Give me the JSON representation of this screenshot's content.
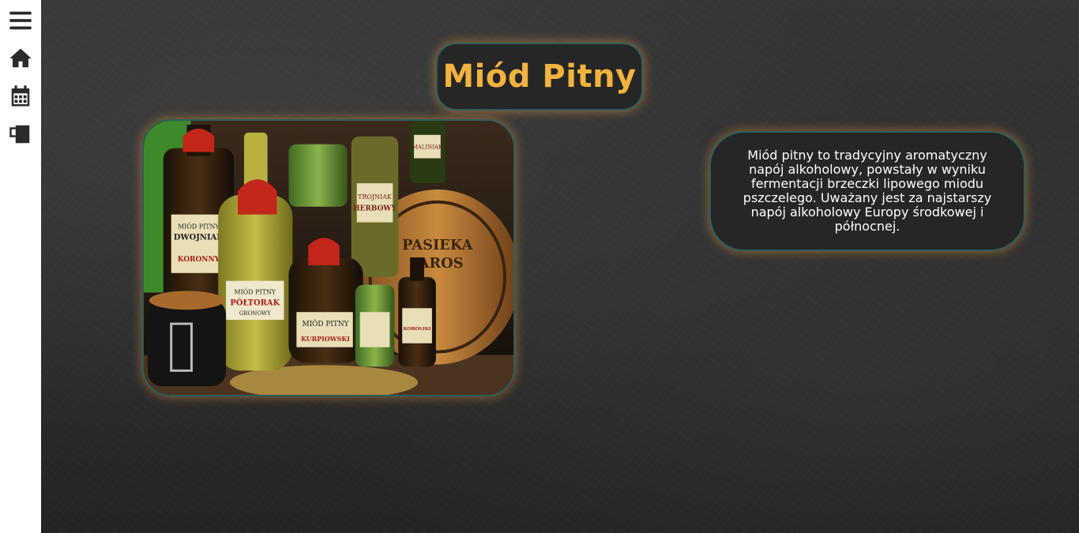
{
  "sidebar": {
    "items": [
      {
        "icon": "menu-icon"
      },
      {
        "icon": "home-icon"
      },
      {
        "icon": "calendar-icon"
      },
      {
        "icon": "mug-icon"
      }
    ]
  },
  "main": {
    "title": "Miód Pitny",
    "description": "Miód pitny to tradycyjny aromatyczny napój alkoholowy, powstały w wyniku fermentacji brzeczki lipowego miodu pszczelego. Uważany jest za najstarszy napój alkoholowy Europy środkowej i północnej.",
    "photo": {
      "labels": [
        "MIÓD PITNY",
        "DWOJNIAK",
        "KORONNY",
        "PÓŁTORAK",
        "GRONOWY",
        "TROJNIAK",
        "HERBOWY",
        "MALINIAK",
        "PASIEKA",
        "JAROS",
        "KURPIOWSKI",
        "KOROLIKI"
      ]
    }
  },
  "colors": {
    "accent": "#f3b23d",
    "border": "#2c5d5e",
    "glow": "#ffaa3c",
    "panel": "#262626",
    "sidebar": "#ffffff"
  }
}
